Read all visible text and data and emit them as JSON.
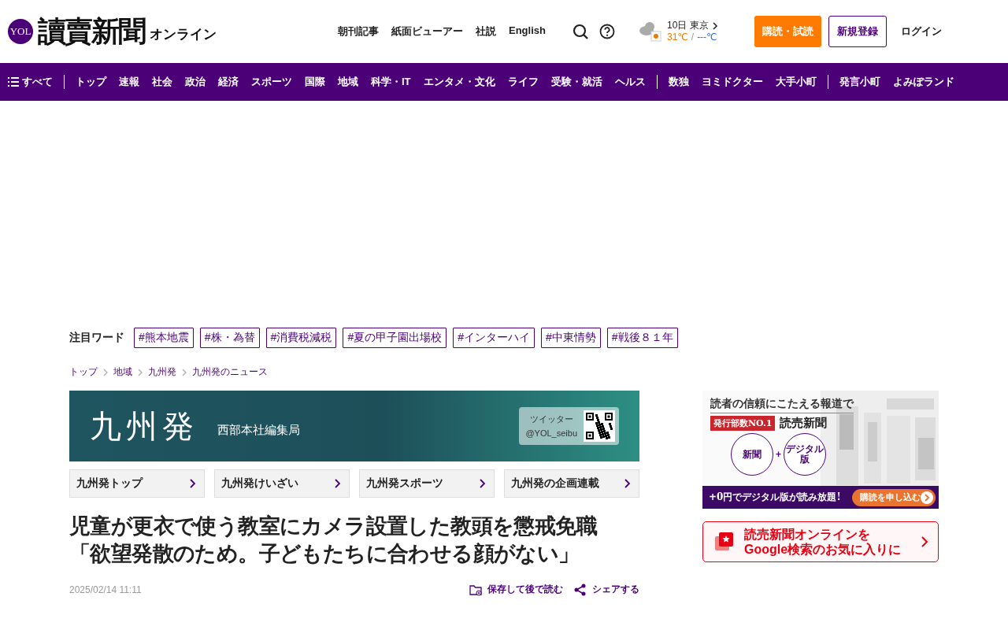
{
  "header": {
    "logo_mark": "YOL",
    "logo_text": "讀賣新聞",
    "logo_suffix": "オンライン",
    "links": [
      "朝刊記事",
      "紙面ビューアー",
      "社説",
      "English"
    ],
    "weather": {
      "date": "10日",
      "city": "東京",
      "high": "31℃",
      "separator": "/",
      "low": "---℃"
    },
    "buttons": [
      {
        "label": "購読・試読",
        "kind": "primary"
      },
      {
        "label": "新規登録",
        "kind": "outline"
      },
      {
        "label": "ログイン",
        "kind": "plain"
      }
    ]
  },
  "nav": {
    "menu_label": "すべて",
    "groups": [
      [
        "トップ",
        "速報",
        "社会",
        "政治",
        "経済",
        "スポーツ",
        "国際",
        "地域",
        "科学・IT",
        "エンタメ・文化",
        "ライフ",
        "受験・就活",
        "ヘルス"
      ],
      [
        "数独",
        "ヨミドクター",
        "大手小町"
      ],
      [
        "発言小町",
        "よみぽランド"
      ]
    ]
  },
  "trend": {
    "label": "注目ワード",
    "tags": [
      "#熊本地震",
      "#株・為替",
      "#消費税減税",
      "#夏の甲子園出場校",
      "#インターハイ",
      "#中東情勢",
      "#戦後８１年"
    ]
  },
  "breadcrumb": [
    "トップ",
    "地域",
    "九州発",
    "九州発のニュース"
  ],
  "section_banner": {
    "title": "九州発",
    "subtitle": "西部本社編集局",
    "social_label": "ツイッター",
    "social_handle": "@YOL_seibu"
  },
  "section_links": [
    "九州発トップ",
    "九州発けいざい",
    "九州発スポーツ",
    "九州発の企画連載"
  ],
  "article": {
    "title_lines": [
      "児童が更衣で使う教室にカメラ設置した教頭を懲戒免職",
      "「欲望発散のため。子どもたちに合わせる顔がない」"
    ],
    "date": "2025/02/14 11:11",
    "actions": [
      {
        "label": "保存して後で読む",
        "kind": "save"
      },
      {
        "label": "シェアする",
        "kind": "share"
      }
    ]
  },
  "sidebar": {
    "promo": {
      "headline": "読者の信頼にこたえる報道で",
      "badge": "発行部数NO.1",
      "brand": "読売新聞",
      "circles": [
        "新聞",
        "デジタル版"
      ],
      "plus": "+",
      "offer": "+0円でデジタル版が読み放題!",
      "cta": "購読を申し込む"
    },
    "google_card": {
      "lines": [
        "読売新聞オンラインを",
        "Google検索のお気に入りに"
      ]
    }
  }
}
